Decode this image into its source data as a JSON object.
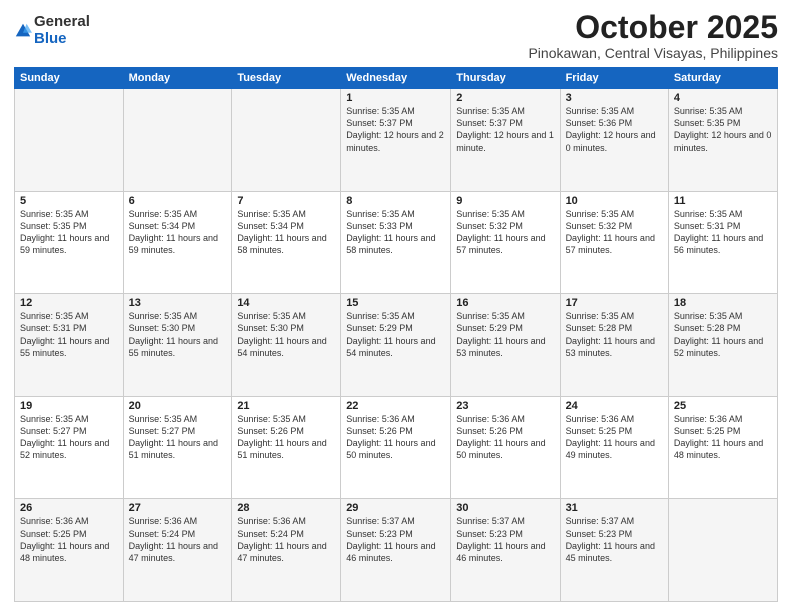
{
  "logo": {
    "general": "General",
    "blue": "Blue"
  },
  "title": "October 2025",
  "subtitle": "Pinokawan, Central Visayas, Philippines",
  "headers": [
    "Sunday",
    "Monday",
    "Tuesday",
    "Wednesday",
    "Thursday",
    "Friday",
    "Saturday"
  ],
  "weeks": [
    [
      {
        "day": "",
        "sunrise": "",
        "sunset": "",
        "daylight": ""
      },
      {
        "day": "",
        "sunrise": "",
        "sunset": "",
        "daylight": ""
      },
      {
        "day": "",
        "sunrise": "",
        "sunset": "",
        "daylight": ""
      },
      {
        "day": "1",
        "sunrise": "Sunrise: 5:35 AM",
        "sunset": "Sunset: 5:37 PM",
        "daylight": "Daylight: 12 hours and 2 minutes."
      },
      {
        "day": "2",
        "sunrise": "Sunrise: 5:35 AM",
        "sunset": "Sunset: 5:37 PM",
        "daylight": "Daylight: 12 hours and 1 minute."
      },
      {
        "day": "3",
        "sunrise": "Sunrise: 5:35 AM",
        "sunset": "Sunset: 5:36 PM",
        "daylight": "Daylight: 12 hours and 0 minutes."
      },
      {
        "day": "4",
        "sunrise": "Sunrise: 5:35 AM",
        "sunset": "Sunset: 5:35 PM",
        "daylight": "Daylight: 12 hours and 0 minutes."
      }
    ],
    [
      {
        "day": "5",
        "sunrise": "Sunrise: 5:35 AM",
        "sunset": "Sunset: 5:35 PM",
        "daylight": "Daylight: 11 hours and 59 minutes."
      },
      {
        "day": "6",
        "sunrise": "Sunrise: 5:35 AM",
        "sunset": "Sunset: 5:34 PM",
        "daylight": "Daylight: 11 hours and 59 minutes."
      },
      {
        "day": "7",
        "sunrise": "Sunrise: 5:35 AM",
        "sunset": "Sunset: 5:34 PM",
        "daylight": "Daylight: 11 hours and 58 minutes."
      },
      {
        "day": "8",
        "sunrise": "Sunrise: 5:35 AM",
        "sunset": "Sunset: 5:33 PM",
        "daylight": "Daylight: 11 hours and 58 minutes."
      },
      {
        "day": "9",
        "sunrise": "Sunrise: 5:35 AM",
        "sunset": "Sunset: 5:32 PM",
        "daylight": "Daylight: 11 hours and 57 minutes."
      },
      {
        "day": "10",
        "sunrise": "Sunrise: 5:35 AM",
        "sunset": "Sunset: 5:32 PM",
        "daylight": "Daylight: 11 hours and 57 minutes."
      },
      {
        "day": "11",
        "sunrise": "Sunrise: 5:35 AM",
        "sunset": "Sunset: 5:31 PM",
        "daylight": "Daylight: 11 hours and 56 minutes."
      }
    ],
    [
      {
        "day": "12",
        "sunrise": "Sunrise: 5:35 AM",
        "sunset": "Sunset: 5:31 PM",
        "daylight": "Daylight: 11 hours and 55 minutes."
      },
      {
        "day": "13",
        "sunrise": "Sunrise: 5:35 AM",
        "sunset": "Sunset: 5:30 PM",
        "daylight": "Daylight: 11 hours and 55 minutes."
      },
      {
        "day": "14",
        "sunrise": "Sunrise: 5:35 AM",
        "sunset": "Sunset: 5:30 PM",
        "daylight": "Daylight: 11 hours and 54 minutes."
      },
      {
        "day": "15",
        "sunrise": "Sunrise: 5:35 AM",
        "sunset": "Sunset: 5:29 PM",
        "daylight": "Daylight: 11 hours and 54 minutes."
      },
      {
        "day": "16",
        "sunrise": "Sunrise: 5:35 AM",
        "sunset": "Sunset: 5:29 PM",
        "daylight": "Daylight: 11 hours and 53 minutes."
      },
      {
        "day": "17",
        "sunrise": "Sunrise: 5:35 AM",
        "sunset": "Sunset: 5:28 PM",
        "daylight": "Daylight: 11 hours and 53 minutes."
      },
      {
        "day": "18",
        "sunrise": "Sunrise: 5:35 AM",
        "sunset": "Sunset: 5:28 PM",
        "daylight": "Daylight: 11 hours and 52 minutes."
      }
    ],
    [
      {
        "day": "19",
        "sunrise": "Sunrise: 5:35 AM",
        "sunset": "Sunset: 5:27 PM",
        "daylight": "Daylight: 11 hours and 52 minutes."
      },
      {
        "day": "20",
        "sunrise": "Sunrise: 5:35 AM",
        "sunset": "Sunset: 5:27 PM",
        "daylight": "Daylight: 11 hours and 51 minutes."
      },
      {
        "day": "21",
        "sunrise": "Sunrise: 5:35 AM",
        "sunset": "Sunset: 5:26 PM",
        "daylight": "Daylight: 11 hours and 51 minutes."
      },
      {
        "day": "22",
        "sunrise": "Sunrise: 5:36 AM",
        "sunset": "Sunset: 5:26 PM",
        "daylight": "Daylight: 11 hours and 50 minutes."
      },
      {
        "day": "23",
        "sunrise": "Sunrise: 5:36 AM",
        "sunset": "Sunset: 5:26 PM",
        "daylight": "Daylight: 11 hours and 50 minutes."
      },
      {
        "day": "24",
        "sunrise": "Sunrise: 5:36 AM",
        "sunset": "Sunset: 5:25 PM",
        "daylight": "Daylight: 11 hours and 49 minutes."
      },
      {
        "day": "25",
        "sunrise": "Sunrise: 5:36 AM",
        "sunset": "Sunset: 5:25 PM",
        "daylight": "Daylight: 11 hours and 48 minutes."
      }
    ],
    [
      {
        "day": "26",
        "sunrise": "Sunrise: 5:36 AM",
        "sunset": "Sunset: 5:25 PM",
        "daylight": "Daylight: 11 hours and 48 minutes."
      },
      {
        "day": "27",
        "sunrise": "Sunrise: 5:36 AM",
        "sunset": "Sunset: 5:24 PM",
        "daylight": "Daylight: 11 hours and 47 minutes."
      },
      {
        "day": "28",
        "sunrise": "Sunrise: 5:36 AM",
        "sunset": "Sunset: 5:24 PM",
        "daylight": "Daylight: 11 hours and 47 minutes."
      },
      {
        "day": "29",
        "sunrise": "Sunrise: 5:37 AM",
        "sunset": "Sunset: 5:23 PM",
        "daylight": "Daylight: 11 hours and 46 minutes."
      },
      {
        "day": "30",
        "sunrise": "Sunrise: 5:37 AM",
        "sunset": "Sunset: 5:23 PM",
        "daylight": "Daylight: 11 hours and 46 minutes."
      },
      {
        "day": "31",
        "sunrise": "Sunrise: 5:37 AM",
        "sunset": "Sunset: 5:23 PM",
        "daylight": "Daylight: 11 hours and 45 minutes."
      },
      {
        "day": "",
        "sunrise": "",
        "sunset": "",
        "daylight": ""
      }
    ]
  ]
}
